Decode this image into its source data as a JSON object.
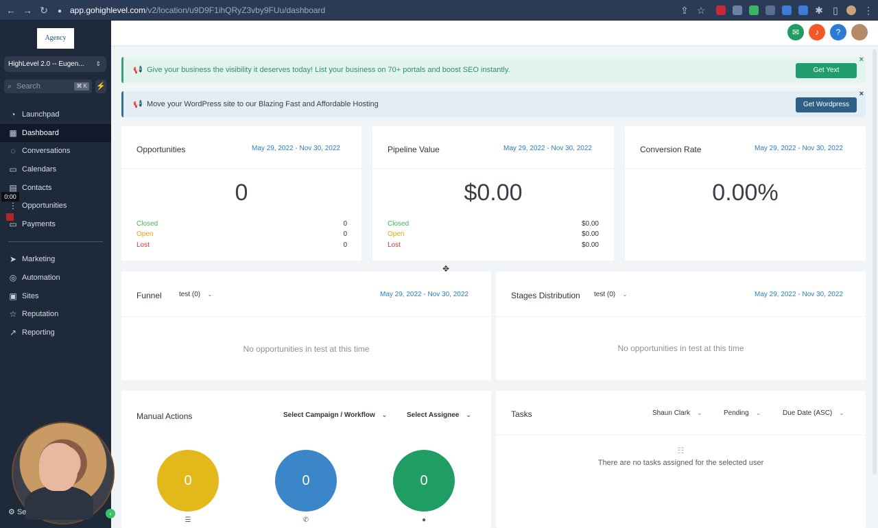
{
  "browser": {
    "url_host": "app.gohighlevel.com",
    "url_path": "/v2/location/u9D9F1ihQRyZ3vby9FUu/dashboard"
  },
  "sidebar": {
    "logo_text": "Agency",
    "account": "HighLevel 2.0 -- Eugen...",
    "search_placeholder": "Search",
    "search_shortcut": "⌘ K",
    "items": [
      {
        "label": "Launchpad",
        "icon": "rocket-icon"
      },
      {
        "label": "Dashboard",
        "icon": "dashboard-icon"
      },
      {
        "label": "Conversations",
        "icon": "chat-icon"
      },
      {
        "label": "Calendars",
        "icon": "calendar-icon"
      },
      {
        "label": "Contacts",
        "icon": "contacts-icon"
      },
      {
        "label": "Opportunities",
        "icon": "funnel-icon"
      },
      {
        "label": "Payments",
        "icon": "payments-icon"
      },
      {
        "label": "Marketing",
        "icon": "send-icon"
      },
      {
        "label": "Automation",
        "icon": "automation-icon"
      },
      {
        "label": "Sites",
        "icon": "sites-icon"
      },
      {
        "label": "Reputation",
        "icon": "star-icon"
      },
      {
        "label": "Reporting",
        "icon": "chart-icon"
      }
    ],
    "recording_time": "0:00",
    "settings_label": "Se"
  },
  "banners": [
    {
      "text": "Give your business the visibility it deserves today! List your business on 70+ portals and boost SEO instantly.",
      "button": "Get Yext",
      "button_color": "#1f9d6e"
    },
    {
      "text": "Move your WordPress site to our Blazing Fast and Affordable Hosting",
      "button": "Get Wordpress",
      "button_color": "#2e5f86"
    }
  ],
  "stats": [
    {
      "title": "Opportunities",
      "date": "May 29, 2022 - Nov 30, 2022",
      "value": "0",
      "rows": [
        {
          "label": "Closed",
          "value": "0"
        },
        {
          "label": "Open",
          "value": "0"
        },
        {
          "label": "Lost",
          "value": "0"
        }
      ]
    },
    {
      "title": "Pipeline Value",
      "date": "May 29, 2022 - Nov 30, 2022",
      "value": "$0.00",
      "rows": [
        {
          "label": "Closed",
          "value": "$0.00"
        },
        {
          "label": "Open",
          "value": "$0.00"
        },
        {
          "label": "Lost",
          "value": "$0.00"
        }
      ]
    },
    {
      "title": "Conversion Rate",
      "date": "May 29, 2022 - Nov 30, 2022",
      "value": "0.00%"
    }
  ],
  "status_colors": {
    "closed": "#3fb950",
    "open": "#e8a317",
    "lost": "#d0342c"
  },
  "funnel": {
    "title": "Funnel",
    "select": "test (0)",
    "date": "May 29, 2022 - Nov 30, 2022",
    "empty": "No opportunities in test at this time"
  },
  "stages": {
    "title": "Stages Distribution",
    "select": "test (0)",
    "date": "May 29, 2022 - Nov 30, 2022",
    "empty": "No opportunities in test at this time"
  },
  "manual_actions": {
    "title": "Manual Actions",
    "campaign_select": "Select Campaign / Workflow",
    "assignee_select": "Select Assignee",
    "bubbles": [
      {
        "value": "0",
        "color": "#e3b81b",
        "icon": "list-icon"
      },
      {
        "value": "0",
        "color": "#3a86c8",
        "icon": "phone-icon"
      },
      {
        "value": "0",
        "color": "#1f9d63",
        "icon": "sms-icon"
      }
    ]
  },
  "tasks": {
    "title": "Tasks",
    "user": "Shaun Clark",
    "status": "Pending",
    "sort": "Due Date (ASC)",
    "empty": "There are no tasks assigned for the selected user"
  }
}
